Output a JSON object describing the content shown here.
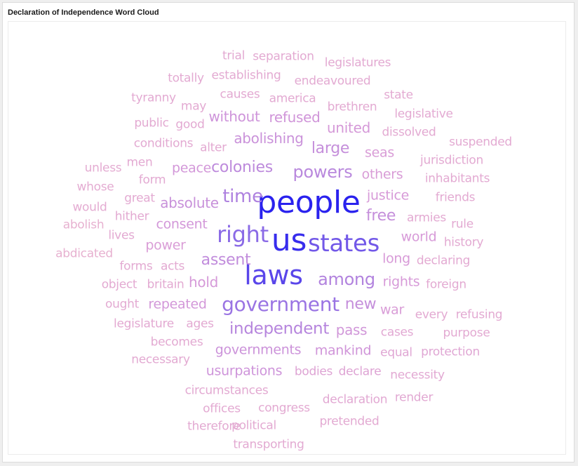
{
  "title": "Declaration of Independence Word Cloud",
  "chart_data": {
    "type": "wordcloud",
    "title": "Declaration of Independence Word Cloud",
    "color_scale": [
      "#e9b3cf",
      "#d79ad8",
      "#b283de",
      "#8a6ae6",
      "#2a22ee"
    ],
    "words": [
      {
        "text": "people",
        "weight": 1.0
      },
      {
        "text": "us",
        "weight": 0.97
      },
      {
        "text": "laws",
        "weight": 0.9
      },
      {
        "text": "states",
        "weight": 0.85
      },
      {
        "text": "right",
        "weight": 0.8
      },
      {
        "text": "government",
        "weight": 0.72
      },
      {
        "text": "time",
        "weight": 0.62
      },
      {
        "text": "among",
        "weight": 0.6
      },
      {
        "text": "independent",
        "weight": 0.58
      },
      {
        "text": "powers",
        "weight": 0.56
      },
      {
        "text": "colonies",
        "weight": 0.54
      },
      {
        "text": "assent",
        "weight": 0.52
      },
      {
        "text": "new",
        "weight": 0.5
      },
      {
        "text": "large",
        "weight": 0.5
      },
      {
        "text": "free",
        "weight": 0.5
      },
      {
        "text": "absolute",
        "weight": 0.48
      },
      {
        "text": "abolishing",
        "weight": 0.47
      },
      {
        "text": "governments",
        "weight": 0.46
      },
      {
        "text": "usurpations",
        "weight": 0.45
      },
      {
        "text": "without",
        "weight": 0.45
      },
      {
        "text": "refused",
        "weight": 0.44
      },
      {
        "text": "mankind",
        "weight": 0.44
      },
      {
        "text": "pass",
        "weight": 0.43
      },
      {
        "text": "consent",
        "weight": 0.42
      },
      {
        "text": "peace",
        "weight": 0.42
      },
      {
        "text": "repeated",
        "weight": 0.42
      },
      {
        "text": "hold",
        "weight": 0.41
      },
      {
        "text": "united",
        "weight": 0.41
      },
      {
        "text": "justice",
        "weight": 0.4
      },
      {
        "text": "world",
        "weight": 0.4
      },
      {
        "text": "rights",
        "weight": 0.4
      },
      {
        "text": "long",
        "weight": 0.39
      },
      {
        "text": "seas",
        "weight": 0.38
      },
      {
        "text": "others",
        "weight": 0.38
      },
      {
        "text": "war",
        "weight": 0.38
      },
      {
        "text": "power",
        "weight": 0.37
      },
      {
        "text": "bodies",
        "weight": 0.32
      },
      {
        "text": "declare",
        "weight": 0.32
      },
      {
        "text": "equal",
        "weight": 0.3
      },
      {
        "text": "protection",
        "weight": 0.3
      },
      {
        "text": "cases",
        "weight": 0.28
      },
      {
        "text": "necessity",
        "weight": 0.28
      },
      {
        "text": "declaration",
        "weight": 0.28
      },
      {
        "text": "render",
        "weight": 0.28
      },
      {
        "text": "pretended",
        "weight": 0.27
      },
      {
        "text": "political",
        "weight": 0.27
      },
      {
        "text": "congress",
        "weight": 0.27
      },
      {
        "text": "offices",
        "weight": 0.27
      },
      {
        "text": "therefore",
        "weight": 0.27
      },
      {
        "text": "transporting",
        "weight": 0.27
      },
      {
        "text": "circumstances",
        "weight": 0.27
      },
      {
        "text": "necessary",
        "weight": 0.27
      },
      {
        "text": "becomes",
        "weight": 0.27
      },
      {
        "text": "legislature",
        "weight": 0.27
      },
      {
        "text": "ages",
        "weight": 0.27
      },
      {
        "text": "ought",
        "weight": 0.27
      },
      {
        "text": "object",
        "weight": 0.27
      },
      {
        "text": "britain",
        "weight": 0.27
      },
      {
        "text": "forms",
        "weight": 0.27
      },
      {
        "text": "acts",
        "weight": 0.27
      },
      {
        "text": "lives",
        "weight": 0.27
      },
      {
        "text": "hither",
        "weight": 0.27
      },
      {
        "text": "great",
        "weight": 0.27
      },
      {
        "text": "form",
        "weight": 0.27
      },
      {
        "text": "men",
        "weight": 0.27
      },
      {
        "text": "alter",
        "weight": 0.27
      },
      {
        "text": "conditions",
        "weight": 0.27
      },
      {
        "text": "public",
        "weight": 0.27
      },
      {
        "text": "good",
        "weight": 0.27
      },
      {
        "text": "tyranny",
        "weight": 0.27
      },
      {
        "text": "may",
        "weight": 0.27
      },
      {
        "text": "causes",
        "weight": 0.27
      },
      {
        "text": "america",
        "weight": 0.27
      },
      {
        "text": "totally",
        "weight": 0.27
      },
      {
        "text": "establishing",
        "weight": 0.27
      },
      {
        "text": "endeavoured",
        "weight": 0.27
      },
      {
        "text": "trial",
        "weight": 0.27
      },
      {
        "text": "separation",
        "weight": 0.27
      },
      {
        "text": "legislatures",
        "weight": 0.27
      },
      {
        "text": "brethren",
        "weight": 0.27
      },
      {
        "text": "state",
        "weight": 0.27
      },
      {
        "text": "legislative",
        "weight": 0.27
      },
      {
        "text": "dissolved",
        "weight": 0.27
      },
      {
        "text": "suspended",
        "weight": 0.27
      },
      {
        "text": "jurisdiction",
        "weight": 0.27
      },
      {
        "text": "inhabitants",
        "weight": 0.27
      },
      {
        "text": "friends",
        "weight": 0.27
      },
      {
        "text": "armies",
        "weight": 0.27
      },
      {
        "text": "rule",
        "weight": 0.27
      },
      {
        "text": "history",
        "weight": 0.27
      },
      {
        "text": "declaring",
        "weight": 0.27
      },
      {
        "text": "foreign",
        "weight": 0.27
      },
      {
        "text": "every",
        "weight": 0.27
      },
      {
        "text": "refusing",
        "weight": 0.27
      },
      {
        "text": "purpose",
        "weight": 0.27
      },
      {
        "text": "unless",
        "weight": 0.26
      },
      {
        "text": "whose",
        "weight": 0.26
      },
      {
        "text": "would",
        "weight": 0.26
      },
      {
        "text": "abolish",
        "weight": 0.22
      },
      {
        "text": "abdicated",
        "weight": 0.22
      }
    ]
  }
}
